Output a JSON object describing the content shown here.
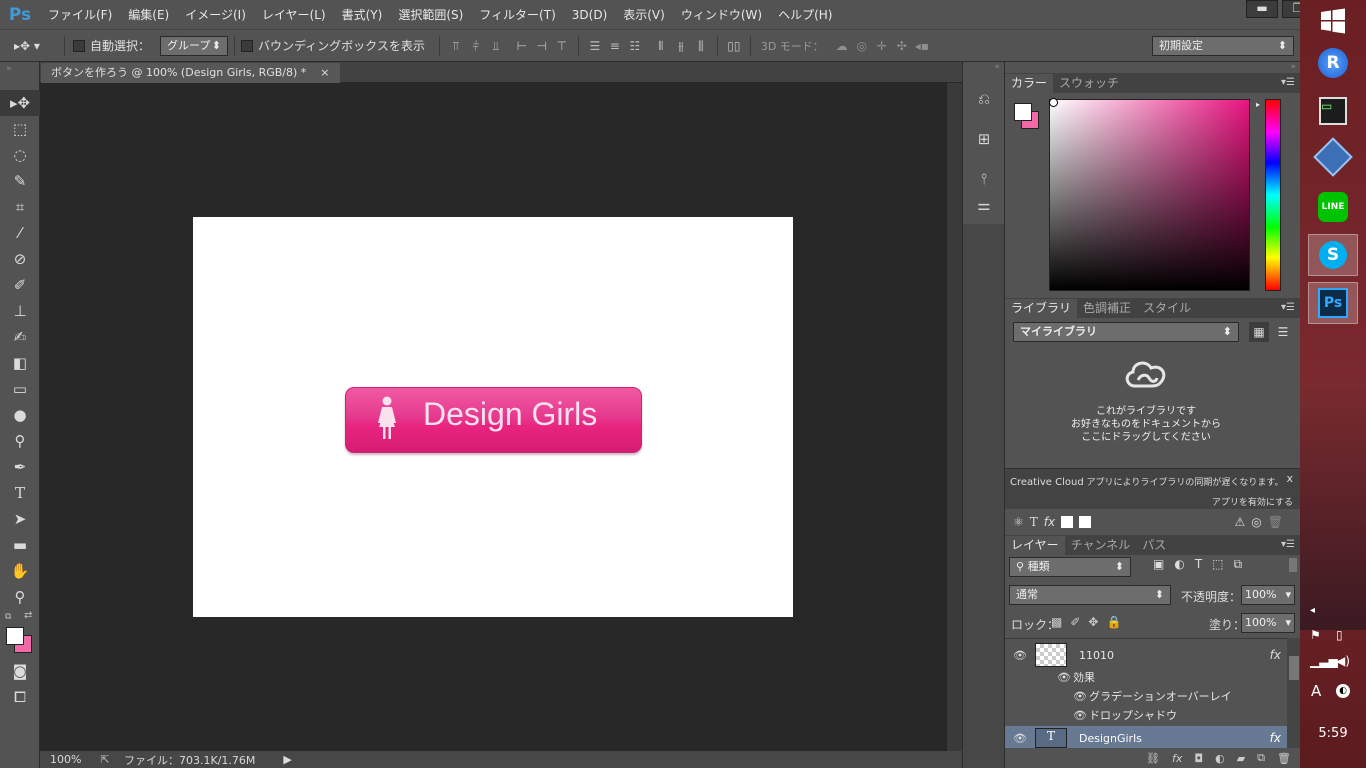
{
  "app": {
    "logo": "Ps"
  },
  "menu": [
    "ファイル(F)",
    "編集(E)",
    "イメージ(I)",
    "レイヤー(L)",
    "書式(Y)",
    "選択範囲(S)",
    "フィルター(T)",
    "3D(D)",
    "表示(V)",
    "ウィンドウ(W)",
    "ヘルプ(H)"
  ],
  "window_controls": {
    "minimize": "▬",
    "restore": "❐",
    "close": "✕"
  },
  "options": {
    "auto_select_label": "自動選択：",
    "auto_select_value": "グループ",
    "bbox_label": "バウンディングボックスを表示",
    "mode3d_label": "3D モード：",
    "workspace": "初期設定"
  },
  "document": {
    "tab_title": "ボタンを作ろう @ 100% (Design Girls, RGB/8) *",
    "tab_close": "×",
    "button_text": "Design Girls",
    "button_colors": {
      "top": "#f25aa3",
      "bottom": "#d61c72"
    }
  },
  "status": {
    "zoom": "100%",
    "file_info": "ファイル：703.1K/1.76M"
  },
  "color_panel": {
    "tabs": [
      "カラー",
      "スウォッチ"
    ],
    "foreground": "#ffffff",
    "background": "#f06aa8",
    "hue": "#e8147f"
  },
  "library_panel": {
    "tabs": [
      "ライブラリ",
      "色調補正",
      "スタイル"
    ],
    "dropdown": "マイライブラリ",
    "empty_line1": "これがライブラリです",
    "empty_line2": "お好きなものをドキュメントから",
    "empty_line3": "ここにドラッグしてください",
    "notice_brand": "Creative Cloud",
    "notice_text": "アプリによりライブラリの同期が遅くなります。",
    "notice_close": "x",
    "notice_link": "アプリを有効にする"
  },
  "layers_panel": {
    "tabs": [
      "レイヤー",
      "チャンネル",
      "パス"
    ],
    "filter_label": "種類",
    "blend_mode": "通常",
    "opacity_label": "不透明度：",
    "opacity_value": "100%",
    "lock_label": "ロック：",
    "fill_label": "塗り：",
    "fill_value": "100%",
    "layers": [
      {
        "name": "11010",
        "fx": "fx"
      },
      {
        "name": "DesignGirls",
        "fx": "fx"
      }
    ],
    "effects_label": "効果",
    "effects": [
      "グラデーションオーバーレイ",
      "ドロップシャドウ"
    ]
  },
  "taskbar": {
    "time": "5:59",
    "ime": "A"
  }
}
